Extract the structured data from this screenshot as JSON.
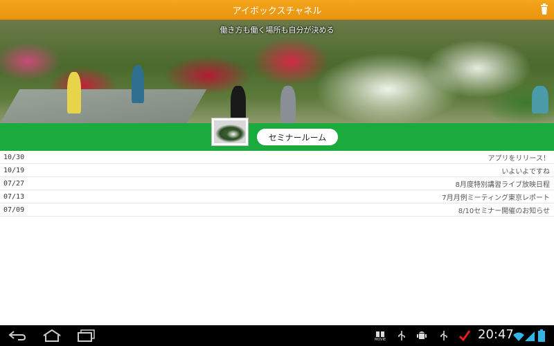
{
  "app": {
    "title": "アイボックスチャネル"
  },
  "hero": {
    "tagline": "働き方も働く場所も自分が決める"
  },
  "room": {
    "button_label": "セミナールーム"
  },
  "news": [
    {
      "date": "10/30",
      "title": "アプリをリリース！"
    },
    {
      "date": "10/19",
      "title": "いよいよですね"
    },
    {
      "date": "07/27",
      "title": "8月度特別講習ライブ放映日程"
    },
    {
      "date": "07/13",
      "title": "7月月例ミーティング東京レポート"
    },
    {
      "date": "07/09",
      "title": "8/10セミナー開催のお知らせ"
    }
  ],
  "system_bar": {
    "time": "20:47",
    "movie_label": "MOVIE"
  },
  "colors": {
    "title_bar": "#f0a01a",
    "green_bar": "#1aaa3e",
    "nav_bar": "#000000"
  },
  "icons": [
    "trash-icon",
    "back-icon",
    "home-icon",
    "recent-apps-icon",
    "movie-icon",
    "usb-icon",
    "android-debug-icon",
    "check-icon",
    "wifi-icon",
    "signal-icon",
    "battery-icon"
  ]
}
